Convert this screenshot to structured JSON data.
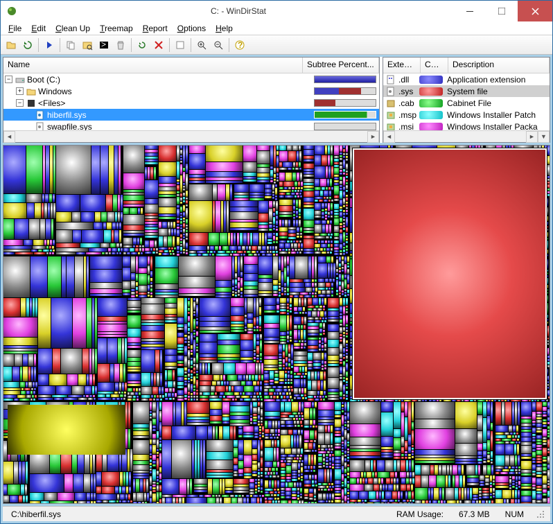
{
  "window": {
    "title": "C: - WinDirStat"
  },
  "menu": {
    "file": "File",
    "edit": "Edit",
    "cleanup": "Clean Up",
    "treemap": "Treemap",
    "report": "Report",
    "options": "Options",
    "help": "Help"
  },
  "tree_header": {
    "name": "Name",
    "subtree": "Subtree Percent..."
  },
  "tree": {
    "root": "Boot (C:)",
    "windows": "Windows",
    "files": "<Files>",
    "hiberfil": "hiberfil.sys",
    "swapfile": "swapfile.sys"
  },
  "ext_header": {
    "ext": "Extensi...",
    "col": "Col...",
    "desc": "Description"
  },
  "ext": {
    "dll": {
      "name": ".dll",
      "desc": "Application extension",
      "color": "#4b4be0"
    },
    "sys": {
      "name": ".sys",
      "desc": "System file",
      "color": "#e04a4a"
    },
    "cab": {
      "name": ".cab",
      "desc": "Cabinet File",
      "color": "#2bd246"
    },
    "msp": {
      "name": ".msp",
      "desc": "Windows Installer Patch",
      "color": "#23d9e0"
    },
    "msi": {
      "name": ".msi",
      "desc": "Windows Installer Packa",
      "color": "#d838d8"
    }
  },
  "status": {
    "path": "C:\\hiberfil.sys",
    "ram_label": "RAM Usage:",
    "ram_value": "67.3 MB",
    "num": "NUM"
  }
}
